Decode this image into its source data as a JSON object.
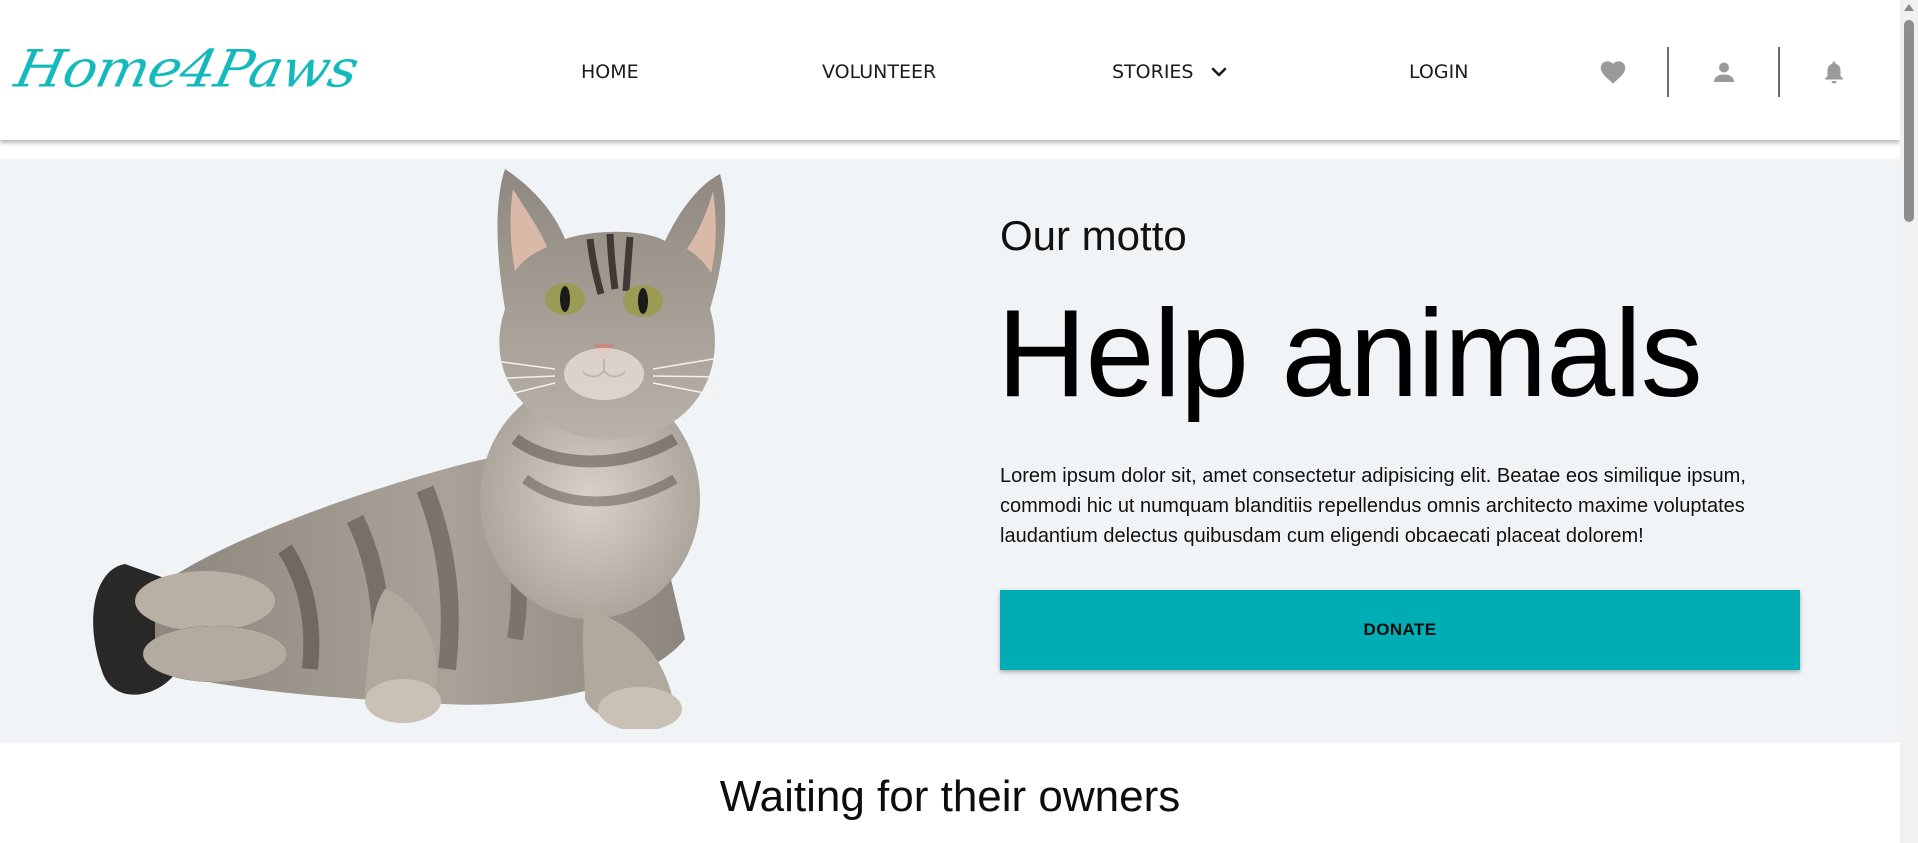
{
  "header": {
    "logo_text": "Home4Paws",
    "nav": {
      "home": "HOME",
      "volunteer": "VOLUNTEER",
      "stories": "STORIES",
      "login": "LOGIN"
    },
    "icons": [
      "heart-icon",
      "user-icon",
      "bell-icon"
    ]
  },
  "hero": {
    "motto": "Our motto",
    "headline": "Help animals",
    "body": "Lorem ipsum dolor sit, amet consectetur adipisicing elit. Beatae eos similique ipsum, commodi hic ut numquam blanditiis repellendus omnis architecto maxime voluptates laudantium delectus quibusdam cum eligendi obcaecati placeat dolorem!",
    "donate_label": "DONATE"
  },
  "section": {
    "title": "Waiting for their owners"
  },
  "colors": {
    "brand": "#13b9bd",
    "button": "#00adb4",
    "hero_background": "#f1f4f7",
    "icon_gray": "#9a9a9a"
  }
}
